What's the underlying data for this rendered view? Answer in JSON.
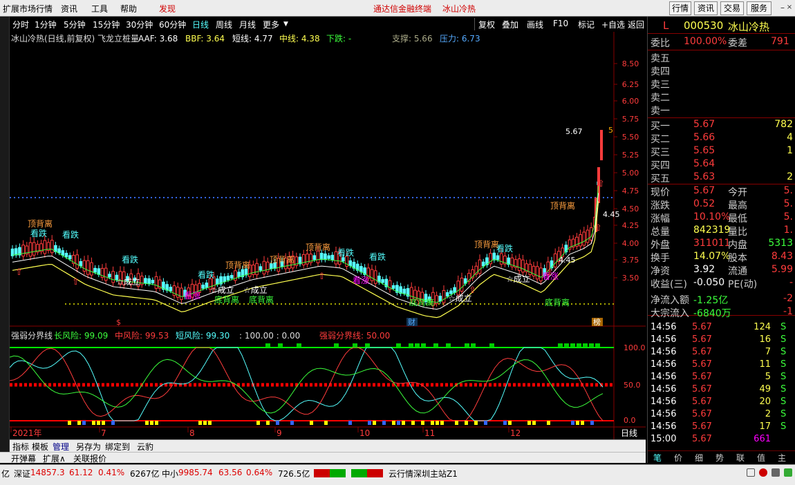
{
  "menu": {
    "items": [
      "扩展市场行情",
      "资讯",
      "工具",
      "帮助",
      "发现"
    ],
    "center_links": [
      "通达信金融终端",
      "冰山冷热"
    ],
    "right_buttons": [
      "行情",
      "资讯",
      "交易",
      "服务"
    ]
  },
  "toolbar": {
    "periods": [
      "分时",
      "1分钟",
      "5分钟",
      "15分钟",
      "30分钟",
      "60分钟",
      "日线",
      "周线",
      "月线",
      "更多"
    ],
    "active_period": "日线",
    "tools": [
      "复权",
      "叠加",
      "画线",
      "F10",
      "标记",
      "+自选",
      "返回"
    ]
  },
  "chart_header": {
    "title": "冰山冷热(日线,前复权) 飞龙立桩量",
    "aaf": "AAF: 3.68",
    "bbf": "BBF: 3.64",
    "short": "短线: 4.77",
    "mid": "中线: 4.38",
    "down": "下跌: -",
    "support": "支撑: 5.66",
    "pressure": "压力: 6.73"
  },
  "price_axis": [
    "8.50",
    "6.25",
    "6.00",
    "5.75",
    "5.50",
    "5.25",
    "5.00",
    "4.75",
    "4.50",
    "4.25",
    "4.00",
    "3.75",
    "3.50"
  ],
  "price_labels": {
    "top": "5.67",
    "p45": "4.45",
    "p45b": "4.45",
    "p5": "5"
  },
  "markers": {
    "top_div": "顶背离",
    "bottom_div": "底背离",
    "watch_fall": "看跌",
    "watch_rise": "看涨",
    "done": "☆成立",
    "cai": "财",
    "bang": "榜"
  },
  "indicator_header": {
    "name": "强弱分界线",
    "long_risk": "长风险: 99.09",
    "mid_risk": "中风险: 99.53",
    "short_risk": "短风险: 99.30",
    "vals": ": 100.00 : 0.00",
    "divide": "强弱分界线: 50.00"
  },
  "indicator_axis": [
    "100.0",
    "50.0",
    "0.0"
  ],
  "date_axis": [
    "2021年",
    "7",
    "8",
    "9",
    "10",
    "11",
    "12"
  ],
  "date_axis_mode": "日线",
  "bottom_tabs": [
    "指标",
    "模板",
    "管理",
    "另存为",
    "绑定到",
    "云豹"
  ],
  "bottom_tabs2": [
    "开弹幕",
    "扩展∧",
    "关联报价"
  ],
  "stock": {
    "flag": "L",
    "code": "000530",
    "name": "冰山冷热"
  },
  "order_book": {
    "wei_bi_label": "委比",
    "wei_bi": "100.00%",
    "wei_cha_label": "委差",
    "wei_cha": "791",
    "sells": [
      [
        "卖五",
        ""
      ],
      [
        "卖四",
        ""
      ],
      [
        "卖三",
        ""
      ],
      [
        "卖二",
        ""
      ],
      [
        "卖一",
        ""
      ]
    ],
    "buys": [
      [
        "买一",
        "5.67",
        "782"
      ],
      [
        "买二",
        "5.66",
        "4"
      ],
      [
        "买三",
        "5.65",
        "1"
      ],
      [
        "买四",
        "5.64",
        ""
      ],
      [
        "买五",
        "5.63",
        "2"
      ]
    ]
  },
  "quote": [
    [
      "现价",
      "5.67",
      "今开",
      "5."
    ],
    [
      "涨跌",
      "0.52",
      "最高",
      "5."
    ],
    [
      "涨幅",
      "10.10%",
      "最低",
      "5."
    ],
    [
      "总量",
      "842319",
      "量比",
      "1."
    ],
    [
      "外盘",
      "311011",
      "内盘",
      "5313"
    ],
    [
      "换手",
      "14.07%",
      "股本",
      "8.43"
    ],
    [
      "净资",
      "3.92",
      "流通",
      "5.99"
    ],
    [
      "收益(三)",
      "-0.050",
      "PE(动)",
      "-"
    ],
    [
      "净流入额",
      "-1.25亿",
      "",
      "-2"
    ],
    [
      "大宗流入",
      "-6840万",
      "",
      "-1"
    ]
  ],
  "ticks": [
    [
      "14:56",
      "5.67",
      "124",
      "S"
    ],
    [
      "14:56",
      "5.67",
      "16",
      "S"
    ],
    [
      "14:56",
      "5.67",
      "7",
      "S"
    ],
    [
      "14:56",
      "5.67",
      "11",
      "S"
    ],
    [
      "14:56",
      "5.67",
      "5",
      "S"
    ],
    [
      "14:56",
      "5.67",
      "49",
      "S"
    ],
    [
      "14:56",
      "5.67",
      "20",
      "S"
    ],
    [
      "14:56",
      "5.67",
      "2",
      "S"
    ],
    [
      "14:56",
      "5.67",
      "17",
      "S"
    ],
    [
      "15:00",
      "5.67",
      "661",
      ""
    ]
  ],
  "right_tabs": [
    "笔",
    "价",
    "细",
    "势",
    "联",
    "值",
    "主"
  ],
  "status": {
    "prefix": "亿",
    "sz_label": "深证",
    "sz_val": "14857.3",
    "sz_chg": "61.12",
    "sz_pct": "0.41%",
    "sz_amt": "6267亿",
    "zx_label": "中小",
    "zx_val": "9985.74",
    "zx_chg": "63.56",
    "zx_pct": "0.64%",
    "zx_amt": "726.5亿",
    "server": "云行情深圳主站Z1"
  },
  "colors": {
    "up": "#ff3c3c",
    "down": "#5ff",
    "ma_short": "#fff",
    "ma_mid": "#ffff50",
    "grid": "#800000"
  }
}
